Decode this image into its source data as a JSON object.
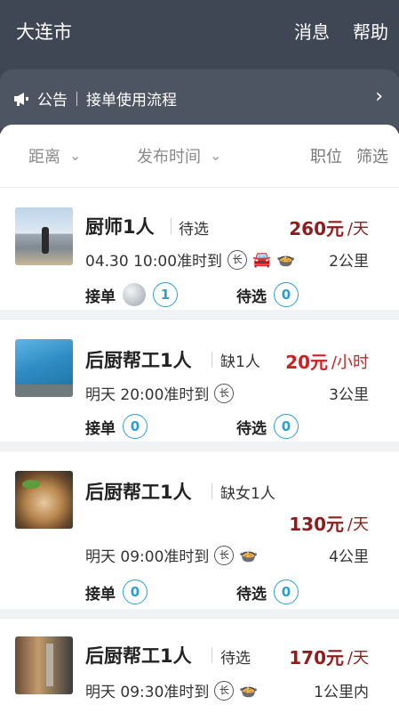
{
  "header": {
    "city": "大连市",
    "messages": "消息",
    "help": "帮助"
  },
  "notice": {
    "label": "公告",
    "text": "接单使用流程"
  },
  "filters": {
    "distance": "距离",
    "publish_time": "发布时间",
    "position": "职位",
    "filter": "筛选"
  },
  "labels": {
    "accept": "接单",
    "pending": "待选",
    "clock_glyph": "长"
  },
  "jobs": [
    {
      "title": "厨师1人",
      "tag": "待选",
      "price": "260元",
      "unit": "/天",
      "time": "04.30 10:00准时到",
      "distance": "2公里",
      "accept_count": "1",
      "pending_count": "0",
      "icons": [
        "car-icon",
        "food-bowl-icon"
      ]
    },
    {
      "title": "后厨帮工1人",
      "tag": "缺1人",
      "price": "20元",
      "unit": "/小时",
      "time": "明天 20:00准时到",
      "distance": "3公里",
      "accept_count": "0",
      "pending_count": "0",
      "icons": []
    },
    {
      "title": "后厨帮工1人",
      "tag": "缺女1人",
      "price": "130元",
      "unit": "/天",
      "time": "明天 09:00准时到",
      "distance": "4公里",
      "accept_count": "0",
      "pending_count": "0",
      "icons": [
        "food-bowl-icon"
      ]
    },
    {
      "title": "后厨帮工1人",
      "tag": "待选",
      "price": "170元",
      "unit": "/天",
      "time": "明天 09:30准时到",
      "distance": "1公里内",
      "icons": [
        "food-bowl-icon"
      ]
    }
  ],
  "colors": {
    "header_bg": "#3f4654",
    "price": "#8f1b1b",
    "badge": "#2a9fd6"
  }
}
